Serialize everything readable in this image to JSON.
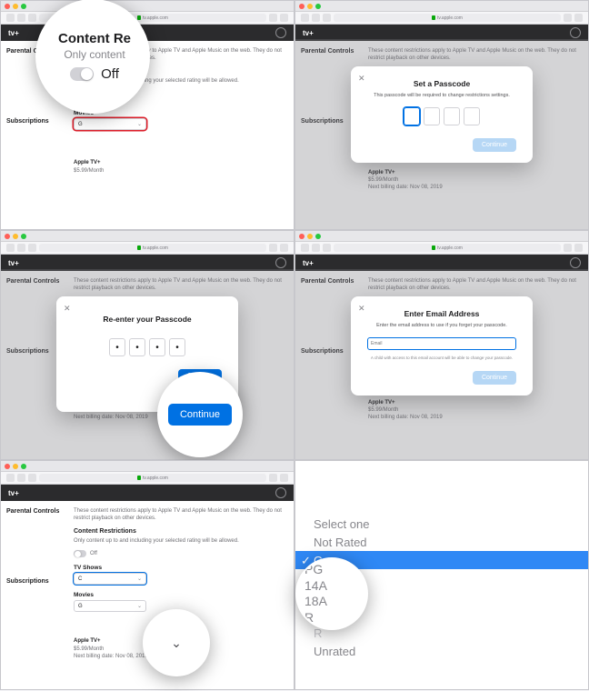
{
  "browser": {
    "url": "tv.apple.com"
  },
  "app_header": {
    "brand": "tv+"
  },
  "sidebar": {
    "parental_label": "Parental Controls",
    "subscriptions_label": "Subscriptions"
  },
  "main": {
    "restrictions_desc": "These content restrictions apply to Apple TV and Apple Music on the web. They do not restrict playback on other devices.",
    "content_restrictions_title": "Content Restrictions",
    "only_content_note": "Only content up to and including your selected rating will be allowed.",
    "off_label": "Off",
    "tv_shows_label": "TV Shows",
    "tv_shows_value": "C",
    "movies_label": "Movies",
    "movies_value": "G"
  },
  "subscription": {
    "name": "Apple TV+",
    "price": "$5.99/Month",
    "next_billing": "Next billing date: Nov 08, 2019"
  },
  "zoom1": {
    "title": "Content Re",
    "subtitle": "Only content",
    "off": "Off"
  },
  "modal_set_passcode": {
    "title": "Set a Passcode",
    "subtitle": "This passcode will be required to change restrictions settings.",
    "continue": "Continue"
  },
  "modal_reenter": {
    "title": "Re-enter your Passcode",
    "continue": "Continue"
  },
  "modal_email": {
    "title": "Enter Email Address",
    "subtitle": "Enter the email address to use if you forget your passcode.",
    "placeholder": "Email",
    "note": "A child with access to this email account will be able to change your passcode.",
    "continue": "Continue"
  },
  "zoom3": {
    "continue": "Continue"
  },
  "rating_list": {
    "select_one": "Select one",
    "not_rated": "Not Rated",
    "g": "G",
    "pg": "PG",
    "a14": "14A",
    "a18": "18A",
    "r": "R",
    "unrated": "Unrated"
  },
  "zoom6": {
    "pg": "PG",
    "a14": "14A",
    "a18": "18A",
    "r": "R"
  }
}
